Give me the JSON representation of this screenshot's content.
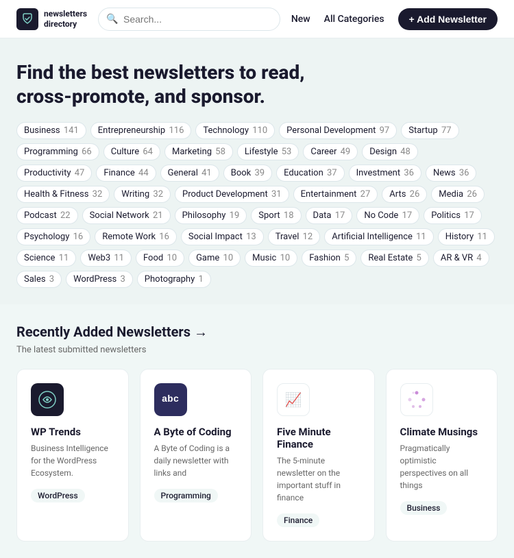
{
  "header": {
    "logo_text_line1": "newsletters",
    "logo_text_line2": "directory",
    "search_placeholder": "Search...",
    "nav_new": "New",
    "nav_all_categories": "All Categories",
    "add_btn": "+ Add Newsletter"
  },
  "hero": {
    "headline": "Find the best newsletters to read, cross-promote, and sponsor."
  },
  "tags": [
    {
      "label": "Business",
      "count": "141"
    },
    {
      "label": "Entrepreneurship",
      "count": "116"
    },
    {
      "label": "Technology",
      "count": "110"
    },
    {
      "label": "Personal Development",
      "count": "97"
    },
    {
      "label": "Startup",
      "count": "77"
    },
    {
      "label": "Programming",
      "count": "66"
    },
    {
      "label": "Culture",
      "count": "64"
    },
    {
      "label": "Marketing",
      "count": "58"
    },
    {
      "label": "Lifestyle",
      "count": "53"
    },
    {
      "label": "Career",
      "count": "49"
    },
    {
      "label": "Design",
      "count": "48"
    },
    {
      "label": "Productivity",
      "count": "47"
    },
    {
      "label": "Finance",
      "count": "44"
    },
    {
      "label": "General",
      "count": "41"
    },
    {
      "label": "Book",
      "count": "39"
    },
    {
      "label": "Education",
      "count": "37"
    },
    {
      "label": "Investment",
      "count": "36"
    },
    {
      "label": "News",
      "count": "36"
    },
    {
      "label": "Health & Fitness",
      "count": "32"
    },
    {
      "label": "Writing",
      "count": "32"
    },
    {
      "label": "Product Development",
      "count": "31"
    },
    {
      "label": "Entertainment",
      "count": "27"
    },
    {
      "label": "Arts",
      "count": "26"
    },
    {
      "label": "Media",
      "count": "26"
    },
    {
      "label": "Podcast",
      "count": "22"
    },
    {
      "label": "Social Network",
      "count": "21"
    },
    {
      "label": "Philosophy",
      "count": "19"
    },
    {
      "label": "Sport",
      "count": "18"
    },
    {
      "label": "Data",
      "count": "17"
    },
    {
      "label": "No Code",
      "count": "17"
    },
    {
      "label": "Politics",
      "count": "17"
    },
    {
      "label": "Psychology",
      "count": "16"
    },
    {
      "label": "Remote Work",
      "count": "16"
    },
    {
      "label": "Social Impact",
      "count": "13"
    },
    {
      "label": "Travel",
      "count": "12"
    },
    {
      "label": "Artificial Intelligence",
      "count": "11"
    },
    {
      "label": "History",
      "count": "11"
    },
    {
      "label": "Science",
      "count": "11"
    },
    {
      "label": "Web3",
      "count": "11"
    },
    {
      "label": "Food",
      "count": "10"
    },
    {
      "label": "Game",
      "count": "10"
    },
    {
      "label": "Music",
      "count": "10"
    },
    {
      "label": "Fashion",
      "count": "5"
    },
    {
      "label": "Real Estate",
      "count": "5"
    },
    {
      "label": "AR & VR",
      "count": "4"
    },
    {
      "label": "Sales",
      "count": "3"
    },
    {
      "label": "WordPress",
      "count": "3"
    },
    {
      "label": "Photography",
      "count": "1"
    }
  ],
  "recently_added": {
    "title": "Recently Added Newsletters →",
    "subtitle": "The latest submitted newsletters",
    "cards": [
      {
        "id": "wp-trends",
        "title": "WP Trends",
        "description": "Business Intelligence for the WordPress Ecosystem.",
        "tag": "WordPress",
        "logo_text": "⌁",
        "logo_bg": "#1a1a2e",
        "logo_color": "#fff"
      },
      {
        "id": "byte-of-coding",
        "title": "A Byte of Coding",
        "description": "A Byte of Coding is a daily newsletter with links and",
        "tag": "Programming",
        "logo_text": "abc",
        "logo_bg": "#2d2d5e",
        "logo_color": "#fff"
      },
      {
        "id": "five-minute-finance",
        "title": "Five Minute Finance",
        "description": "The 5-minute newsletter on the important stuff in finance",
        "tag": "Finance",
        "logo_text": "✉",
        "logo_bg": "#ffffff",
        "logo_color": "#4caf50"
      },
      {
        "id": "climate-musings",
        "title": "Climate Musings",
        "description": "Pragmatically optimistic perspectives on all things",
        "tag": "Business",
        "logo_text": "dots",
        "logo_bg": "#ffffff",
        "logo_color": "#c47fd4"
      }
    ]
  }
}
